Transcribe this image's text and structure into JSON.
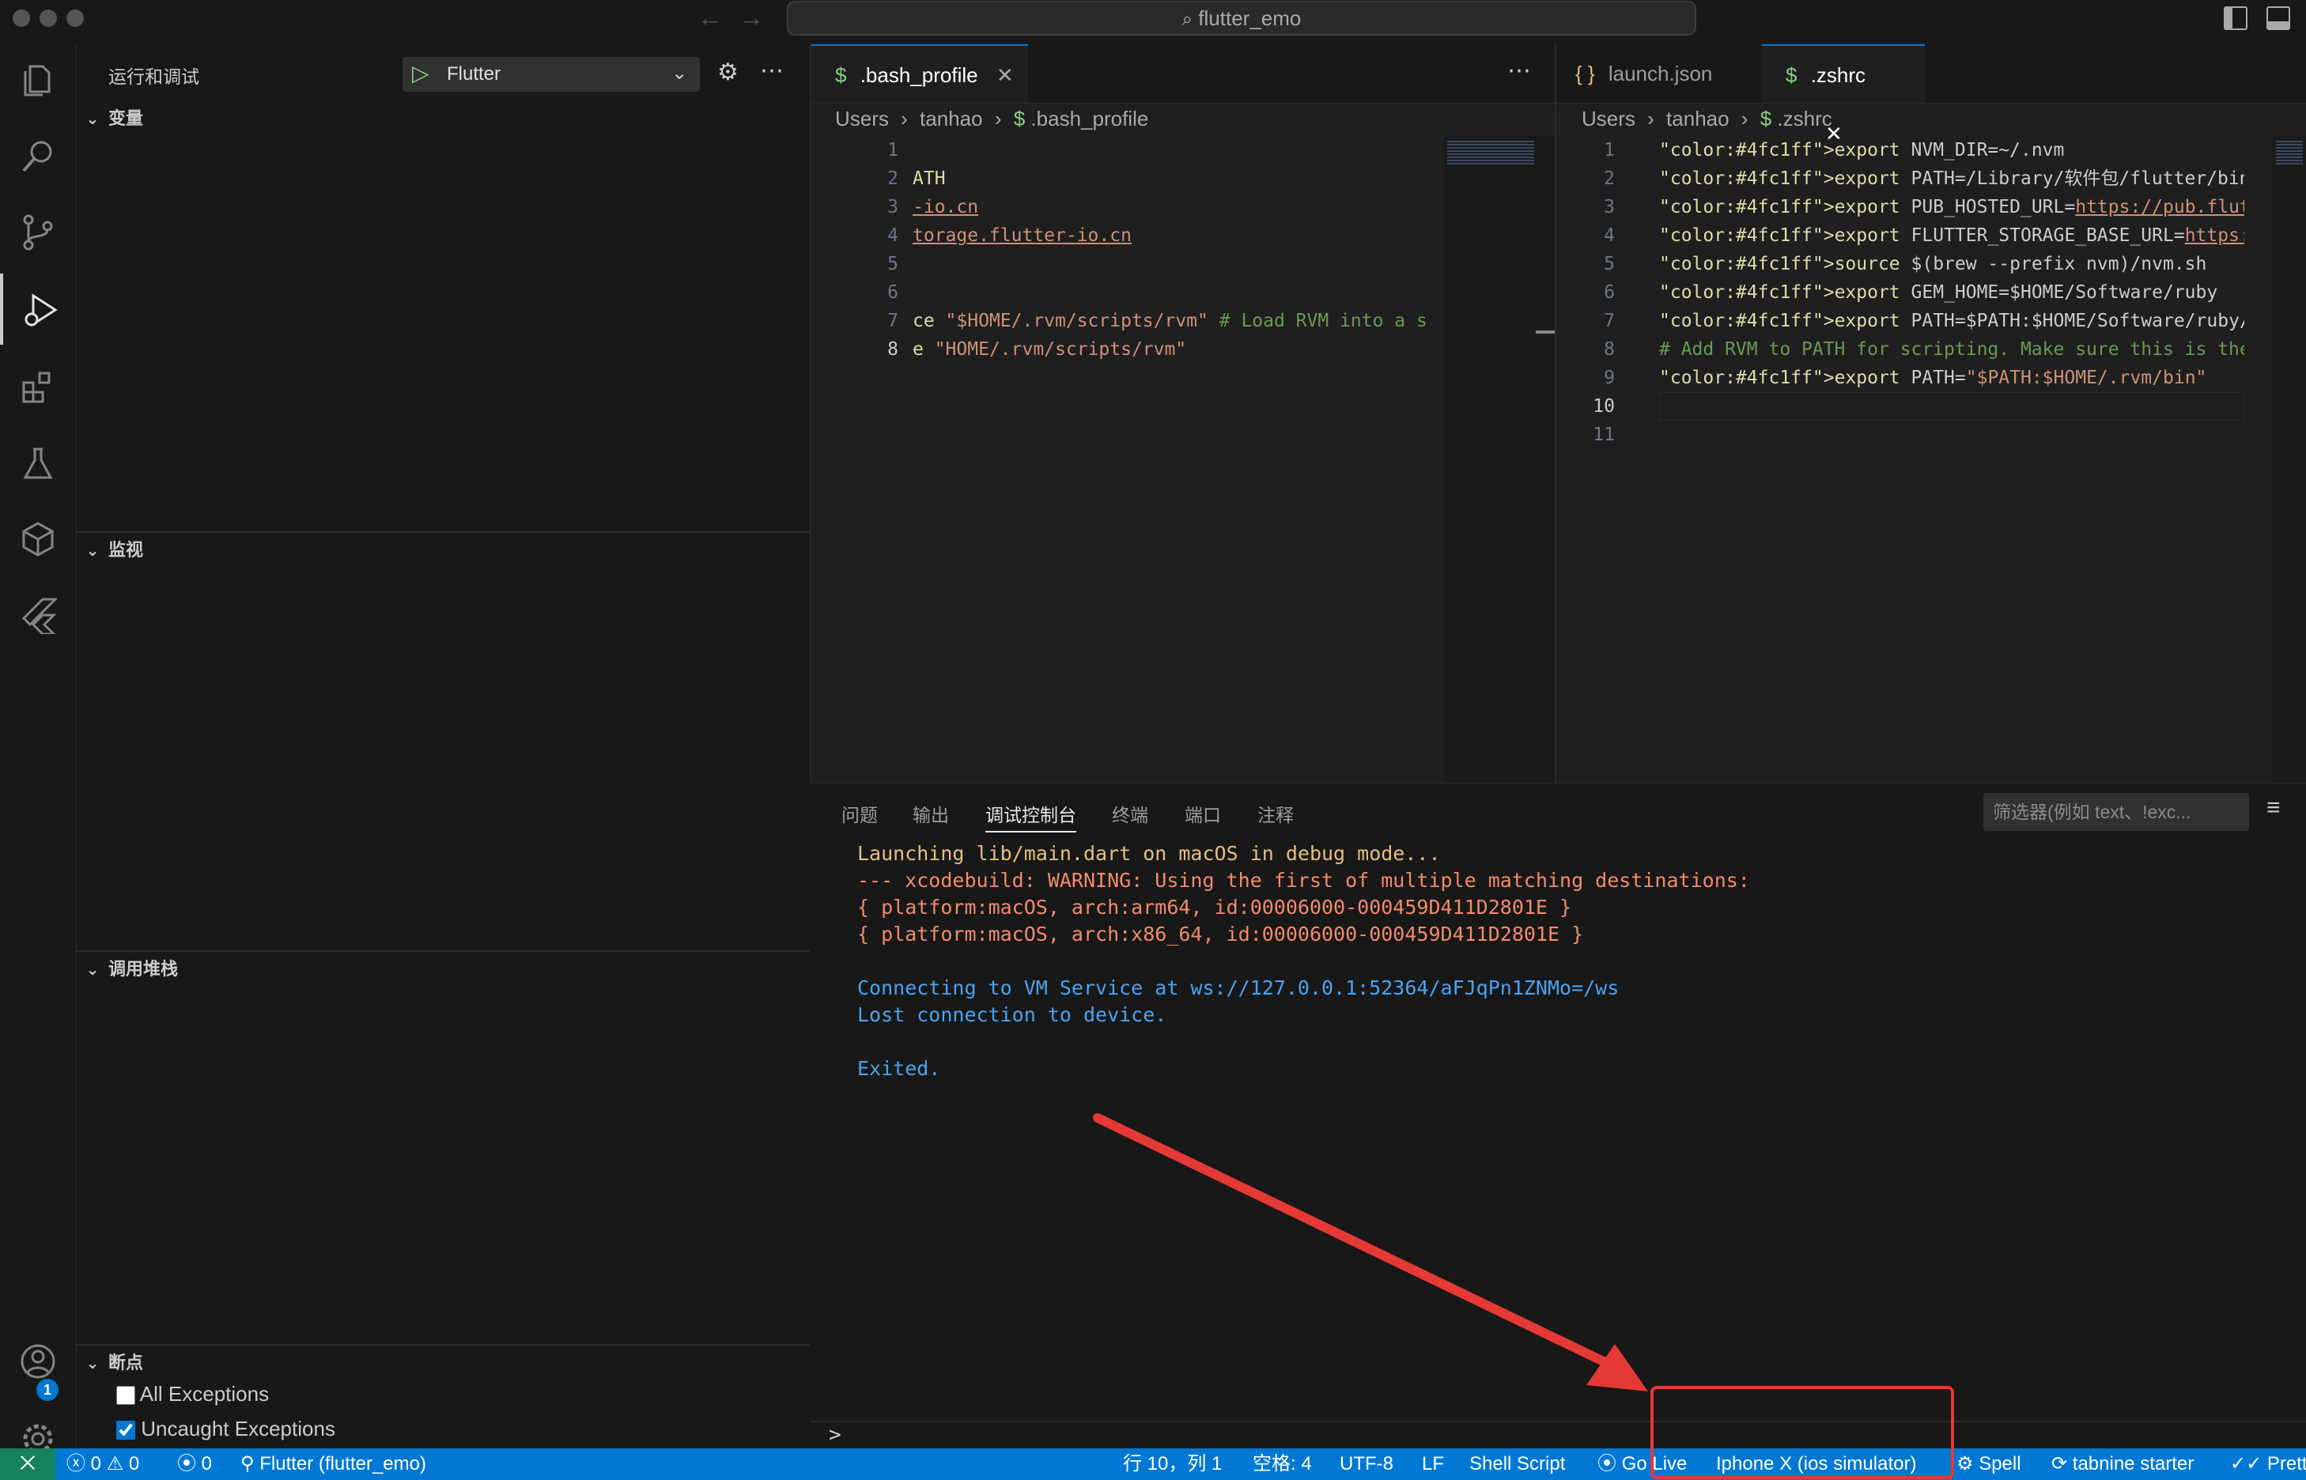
{
  "window": {
    "title": "flutter_emo"
  },
  "activity_bar": {
    "badge_count": "1"
  },
  "sidebar": {
    "title": "运行和调试",
    "launch_config": "Flutter",
    "sections": {
      "variables": "变量",
      "watch": "监视",
      "call_stack": "调用堆栈",
      "breakpoints": "断点"
    },
    "breakpoints": [
      {
        "label": "All Exceptions",
        "checked": false
      },
      {
        "label": "Uncaught Exceptions",
        "checked": true
      }
    ]
  },
  "editor_left": {
    "tab": ".bash_profile",
    "breadcrumb": [
      "Users",
      "tanhao",
      ".bash_profile"
    ],
    "line_numbers": [
      "1",
      "2",
      "3",
      "4",
      "5",
      "6",
      "7",
      "8"
    ],
    "lines": [
      "",
      "ATH",
      "-io.cn",
      "torage.flutter-io.cn",
      "",
      "",
      "ce \"$HOME/.rvm/scripts/rvm\" # Load RVM into a s",
      "e \"HOME/.rvm/scripts/rvm\""
    ]
  },
  "editor_right": {
    "tabs": [
      "launch.json",
      ".zshrc"
    ],
    "breadcrumb": [
      "Users",
      "tanhao",
      ".zshrc"
    ],
    "line_numbers": [
      "1",
      "2",
      "3",
      "4",
      "5",
      "6",
      "7",
      "8",
      "9",
      "10",
      "11"
    ],
    "lines": [
      "export NVM_DIR=~/.nvm",
      "export PATH=/Library/软件包/flutter/bin:$PATH",
      "export PUB_HOSTED_URL=https://pub.flutter-io.cn",
      "export FLUTTER_STORAGE_BASE_URL=https://storage.flutte",
      "source $(brew --prefix nvm)/nvm.sh",
      "export GEM_HOME=$HOME/Software/ruby",
      "export PATH=$PATH:$HOME/Software/ruby/bin",
      "# Add RVM to PATH for scripting. Make sure this is the",
      "export PATH=\"$PATH:$HOME/.rvm/bin\"",
      "",
      ""
    ]
  },
  "panel": {
    "tabs": [
      "问题",
      "输出",
      "调试控制台",
      "终端",
      "端口",
      "注释"
    ],
    "active_tab": "调试控制台",
    "filter_placeholder": "筛选器(例如 text、!exc...",
    "console": [
      {
        "text": "Launching lib/main.dart on macOS in debug mode...",
        "color": "#e5c07b"
      },
      {
        "text": "--- xcodebuild: WARNING: Using the first of multiple matching destinations:",
        "color": "#f28b6b"
      },
      {
        "text": "{ platform:macOS, arch:arm64, id:00006000-000459D411D2801E }",
        "color": "#f28b6b"
      },
      {
        "text": "{ platform:macOS, arch:x86_64, id:00006000-000459D411D2801E }",
        "color": "#f28b6b"
      },
      {
        "text": "",
        "color": "#cccccc"
      },
      {
        "text": "Connecting to VM Service at ws://127.0.0.1:52364/aFJqPn1ZNMo=/ws",
        "color": "#4aa3f0"
      },
      {
        "text": "Lost connection to device.",
        "color": "#4aa3f0"
      },
      {
        "text": "",
        "color": "#cccccc"
      },
      {
        "text": "Exited.",
        "color": "#4aa3f0"
      }
    ],
    "prompt": ">"
  },
  "status_bar": {
    "errors": "0",
    "warnings": "0",
    "ports": "0",
    "debug_target": "Flutter (flutter_emo)",
    "cursor": "行 10，列 1",
    "spaces": "空格: 4",
    "encoding": "UTF-8",
    "eol": "LF",
    "language": "Shell Script",
    "go_live": "Go Live",
    "device": "Iphone X (ios simulator)",
    "spell": "Spell",
    "tabnine": "tabnine starter",
    "prettier": "Prettie"
  },
  "colors": {
    "accent": "#0078d4",
    "annotation_red": "#e53935",
    "keyword": "#4fc1ff",
    "string": "#ce9178",
    "comment": "#6a9955"
  }
}
